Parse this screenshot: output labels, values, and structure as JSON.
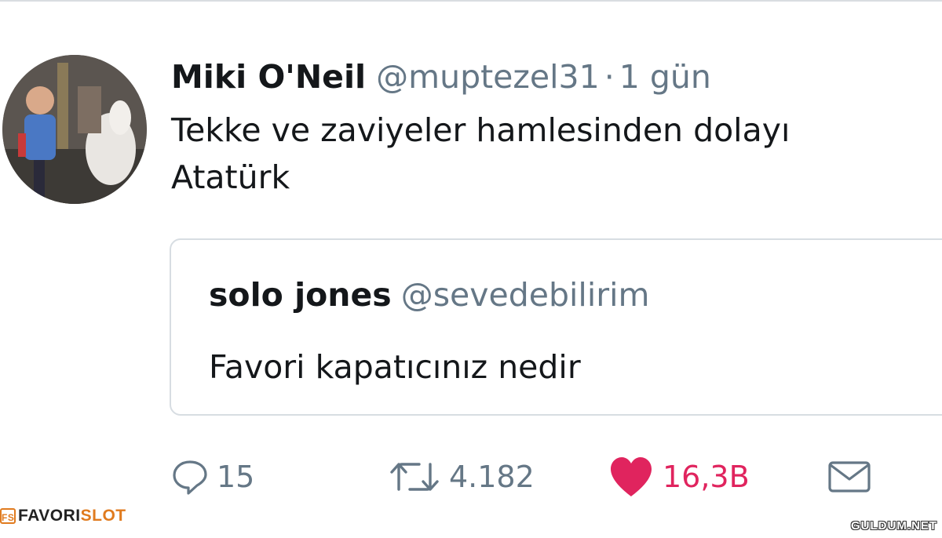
{
  "tweet": {
    "author_name": "Miki O'Neil",
    "author_handle": "@muptezel31",
    "separator": "·",
    "time": "1 gün",
    "text_line1": "Tekke ve zaviyeler hamlesinden dolayı",
    "text_line2": "Atatürk"
  },
  "quoted_tweet": {
    "author_name": "solo jones",
    "author_handle": "@sevedebilirim",
    "text": "Favori kapatıcınız nedir"
  },
  "actions": {
    "reply_count": "15",
    "retweet_count": "4.182",
    "like_count": "16,3B"
  },
  "icons": {
    "reply": "reply-bubble-icon",
    "retweet": "retweet-arrows-icon",
    "like": "heart-icon",
    "dm": "envelope-icon"
  },
  "colors": {
    "text": "#14171a",
    "secondary": "#657786",
    "like": "#e0245e",
    "border": "#d7dde2"
  },
  "watermarks": {
    "left_part1": "FAVORI",
    "left_part2": "SLOT",
    "right": "GULDUM.NET"
  }
}
